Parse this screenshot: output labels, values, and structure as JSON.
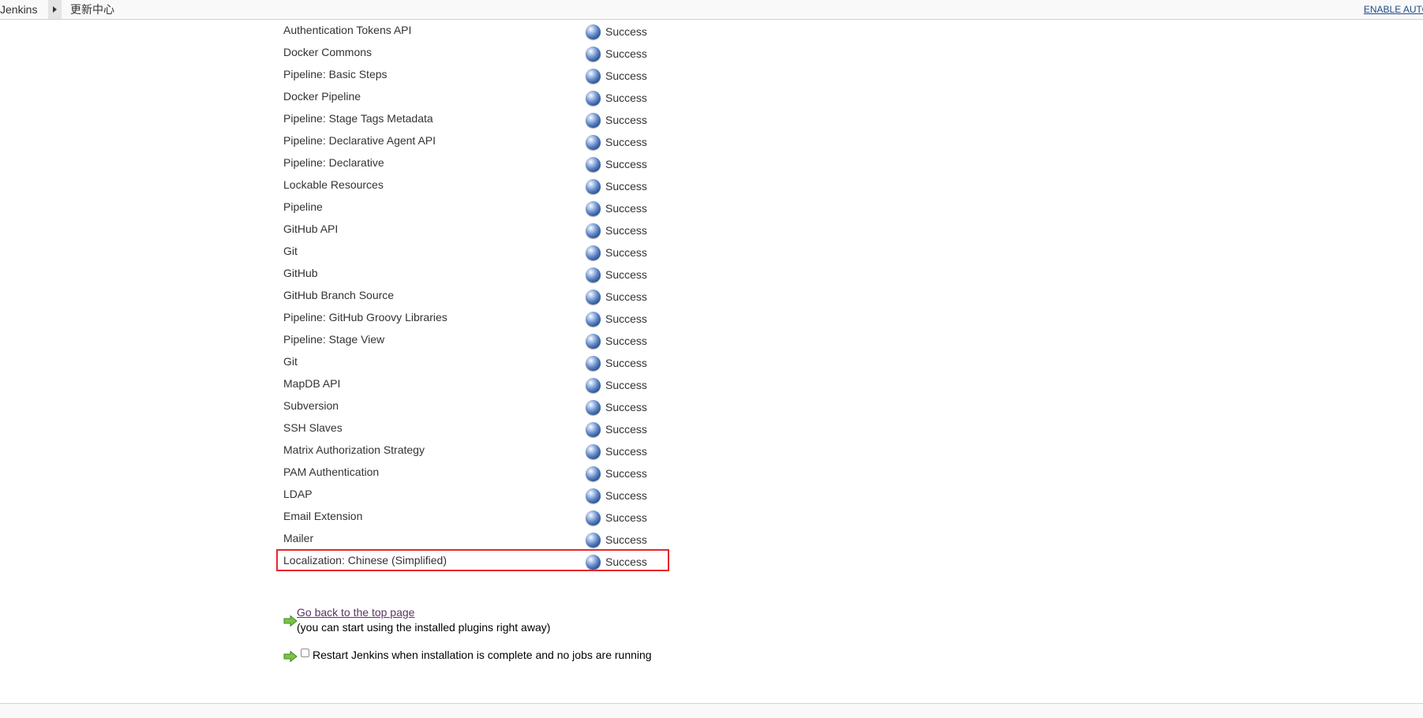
{
  "breadcrumb": {
    "home": "Jenkins",
    "current": "更新中心",
    "auto_refresh": "ENABLE AUTO R"
  },
  "plugins": [
    {
      "name": "Authentication Tokens API",
      "status": "Success"
    },
    {
      "name": "Docker Commons",
      "status": "Success"
    },
    {
      "name": "Pipeline: Basic Steps",
      "status": "Success"
    },
    {
      "name": "Docker Pipeline",
      "status": "Success"
    },
    {
      "name": "Pipeline: Stage Tags Metadata",
      "status": "Success"
    },
    {
      "name": "Pipeline: Declarative Agent API",
      "status": "Success"
    },
    {
      "name": "Pipeline: Declarative",
      "status": "Success"
    },
    {
      "name": "Lockable Resources",
      "status": "Success"
    },
    {
      "name": "Pipeline",
      "status": "Success"
    },
    {
      "name": "GitHub API",
      "status": "Success"
    },
    {
      "name": "Git",
      "status": "Success"
    },
    {
      "name": "GitHub",
      "status": "Success"
    },
    {
      "name": "GitHub Branch Source",
      "status": "Success"
    },
    {
      "name": "Pipeline: GitHub Groovy Libraries",
      "status": "Success"
    },
    {
      "name": "Pipeline: Stage View",
      "status": "Success"
    },
    {
      "name": "Git",
      "status": "Success"
    },
    {
      "name": "MapDB API",
      "status": "Success"
    },
    {
      "name": "Subversion",
      "status": "Success"
    },
    {
      "name": "SSH Slaves",
      "status": "Success"
    },
    {
      "name": "Matrix Authorization Strategy",
      "status": "Success"
    },
    {
      "name": "PAM Authentication",
      "status": "Success"
    },
    {
      "name": "LDAP",
      "status": "Success"
    },
    {
      "name": "Email Extension",
      "status": "Success"
    },
    {
      "name": "Mailer",
      "status": "Success"
    },
    {
      "name": "Localization: Chinese (Simplified)",
      "status": "Success"
    }
  ],
  "status_icon": "blue-ball-icon",
  "highlight_color": "#e8262b",
  "actions": {
    "go_back_link": "Go back to the top page",
    "go_back_note": "(you can start using the installed plugins right away)",
    "restart_label": "Restart Jenkins when installation is complete and no jobs are running",
    "restart_checked": false
  }
}
